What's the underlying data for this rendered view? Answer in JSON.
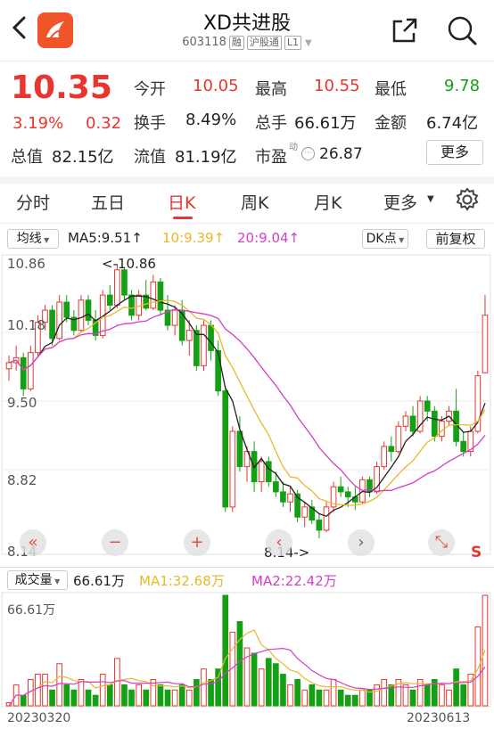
{
  "header": {
    "title": "XD共进股",
    "code": "603118",
    "tags": [
      "融",
      "沪股通",
      "L1"
    ]
  },
  "quote": {
    "price": "10.35",
    "change_pct": "3.19%",
    "change": "0.32",
    "open_label": "今开",
    "open": "10.05",
    "high_label": "最高",
    "high": "10.55",
    "low_label": "最低",
    "low": "9.78",
    "turnover_label": "换手",
    "turnover": "8.49%",
    "volume_label": "总手",
    "volume": "66.61万",
    "amount_label": "金额",
    "amount": "6.74亿",
    "mktcap_label": "总值",
    "mktcap": "82.15亿",
    "float_label": "流值",
    "float": "81.19亿",
    "pe_label": "市盈",
    "pe_sup": "动",
    "pe": "26.87",
    "more_label": "更多"
  },
  "tabs": [
    "分时",
    "五日",
    "日K",
    "周K",
    "月K",
    "更多"
  ],
  "active_tab": "日K",
  "ma_bar": {
    "select": "均线",
    "ma5": "MA5:9.51",
    "ma10": "10:9.39",
    "ma20": "20:9.04",
    "dk": "DK点",
    "fq": "前复权"
  },
  "colors": {
    "red": "#e8352f",
    "green": "#14a014",
    "ma5": "#222222",
    "ma10": "#e8b82a",
    "ma20": "#d23ec8"
  },
  "price_axis": [
    "10.86",
    "10.18",
    "9.50",
    "8.82",
    "8.14"
  ],
  "max_annot": "<-10.86",
  "min_annot": "8.14->",
  "overlay_buttons": [
    "«",
    "−",
    "+",
    "‹",
    "›",
    "⤡"
  ],
  "vol_bar": {
    "select": "成交量",
    "vol": "66.61万",
    "ma1": "MA1:32.68万",
    "ma2": "MA2:22.42万",
    "axis_top": "66.61万"
  },
  "dates": {
    "start": "20230320",
    "end": "20230613"
  },
  "chart_data": {
    "type": "candlestick",
    "price_range": [
      8.14,
      10.86
    ],
    "candles": [
      [
        9.82,
        9.95,
        9.7,
        9.88,
        0
      ],
      [
        9.88,
        10.05,
        9.8,
        9.93,
        4
      ],
      [
        9.93,
        9.98,
        9.55,
        9.62,
        2
      ],
      [
        9.62,
        10.05,
        9.6,
        9.98,
        5
      ],
      [
        9.98,
        10.35,
        9.95,
        10.28,
        6
      ],
      [
        10.28,
        10.45,
        10.2,
        10.4,
        6
      ],
      [
        10.4,
        10.45,
        10.05,
        10.12,
        3
      ],
      [
        10.12,
        10.55,
        10.1,
        10.48,
        8
      ],
      [
        10.48,
        10.55,
        10.28,
        10.33,
        4
      ],
      [
        10.33,
        10.4,
        10.15,
        10.2,
        3
      ],
      [
        10.2,
        10.55,
        10.18,
        10.5,
        5
      ],
      [
        10.5,
        10.55,
        10.25,
        10.3,
        3
      ],
      [
        10.3,
        10.4,
        10.1,
        10.15,
        2
      ],
      [
        10.15,
        10.6,
        10.12,
        10.55,
        6
      ],
      [
        10.55,
        10.65,
        10.4,
        10.45,
        4
      ],
      [
        10.45,
        10.86,
        10.42,
        10.8,
        9
      ],
      [
        10.8,
        10.82,
        10.5,
        10.55,
        4
      ],
      [
        10.55,
        10.6,
        10.3,
        10.35,
        3
      ],
      [
        10.35,
        10.6,
        10.3,
        10.55,
        4
      ],
      [
        10.55,
        10.7,
        10.4,
        10.42,
        3
      ],
      [
        10.42,
        10.75,
        10.4,
        10.68,
        5
      ],
      [
        10.68,
        10.72,
        10.35,
        10.4,
        4
      ],
      [
        10.4,
        10.55,
        10.2,
        10.25,
        3
      ],
      [
        10.25,
        10.45,
        10.15,
        10.4,
        3
      ],
      [
        10.4,
        10.5,
        10.05,
        10.1,
        4
      ],
      [
        10.1,
        10.3,
        9.95,
        10.2,
        3
      ],
      [
        10.2,
        10.25,
        9.8,
        9.85,
        5
      ],
      [
        9.85,
        10.3,
        9.8,
        10.25,
        7
      ],
      [
        10.25,
        10.3,
        9.9,
        10.0,
        5
      ],
      [
        10.0,
        10.1,
        9.55,
        9.6,
        7
      ],
      [
        9.6,
        9.65,
        8.4,
        8.45,
        21
      ],
      [
        8.45,
        9.25,
        8.4,
        9.2,
        14
      ],
      [
        9.2,
        9.35,
        8.8,
        8.85,
        16
      ],
      [
        8.85,
        9.05,
        8.7,
        9.0,
        11
      ],
      [
        9.0,
        9.1,
        8.6,
        8.7,
        10
      ],
      [
        8.7,
        8.95,
        8.6,
        8.9,
        7
      ],
      [
        8.9,
        8.95,
        8.65,
        8.7,
        9
      ],
      [
        8.7,
        8.8,
        8.55,
        8.6,
        8
      ],
      [
        8.6,
        8.7,
        8.45,
        8.5,
        6
      ],
      [
        8.5,
        8.65,
        8.4,
        8.58,
        4
      ],
      [
        8.58,
        8.62,
        8.3,
        8.35,
        5
      ],
      [
        8.35,
        8.5,
        8.25,
        8.45,
        3
      ],
      [
        8.45,
        8.52,
        8.28,
        8.32,
        4
      ],
      [
        8.32,
        8.38,
        8.14,
        8.22,
        3
      ],
      [
        8.22,
        8.5,
        8.2,
        8.45,
        3
      ],
      [
        8.45,
        8.7,
        8.4,
        8.65,
        5
      ],
      [
        8.65,
        8.75,
        8.55,
        8.6,
        3
      ],
      [
        8.6,
        8.65,
        8.45,
        8.55,
        2
      ],
      [
        8.55,
        8.65,
        8.42,
        8.5,
        2
      ],
      [
        8.5,
        8.75,
        8.48,
        8.72,
        3
      ],
      [
        8.72,
        8.75,
        8.55,
        8.6,
        3
      ],
      [
        8.6,
        8.9,
        8.58,
        8.85,
        4
      ],
      [
        8.85,
        9.1,
        8.82,
        9.05,
        5
      ],
      [
        9.05,
        9.15,
        8.9,
        9.0,
        4
      ],
      [
        9.0,
        9.3,
        8.98,
        9.25,
        5
      ],
      [
        9.25,
        9.4,
        9.2,
        9.35,
        4
      ],
      [
        9.35,
        9.45,
        9.15,
        9.2,
        3
      ],
      [
        9.2,
        9.55,
        9.18,
        9.5,
        5
      ],
      [
        9.5,
        9.55,
        9.3,
        9.4,
        4
      ],
      [
        9.4,
        9.45,
        9.1,
        9.15,
        5
      ],
      [
        9.15,
        9.35,
        9.1,
        9.3,
        4
      ],
      [
        9.3,
        9.45,
        9.25,
        9.4,
        3
      ],
      [
        9.4,
        9.62,
        9.05,
        9.1,
        7
      ],
      [
        9.1,
        9.2,
        8.95,
        9.0,
        4
      ],
      [
        9.0,
        9.25,
        8.95,
        9.2,
        6
      ],
      [
        9.2,
        9.8,
        9.18,
        9.75,
        15
      ],
      [
        9.78,
        10.55,
        9.78,
        10.35,
        21
      ]
    ],
    "vol_unit": "万手 (relative)"
  }
}
